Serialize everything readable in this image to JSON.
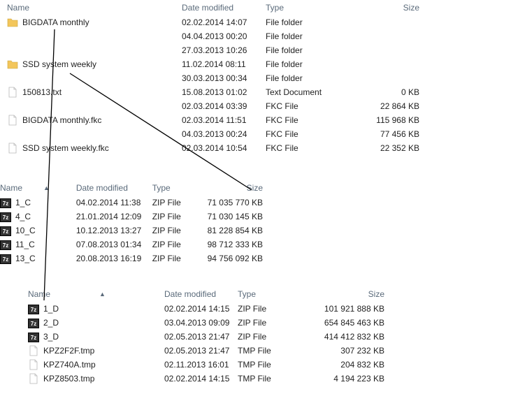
{
  "headers": {
    "name": "Name",
    "date": "Date modified",
    "type": "Type",
    "size": "Size"
  },
  "pane1": {
    "rows": [
      {
        "icon": "folder",
        "name": "BIGDATA monthly",
        "date": "02.02.2014 14:07",
        "type": "File folder",
        "size": ""
      },
      {
        "icon": "",
        "name": "",
        "date": "04.04.2013 00:20",
        "type": "File folder",
        "size": ""
      },
      {
        "icon": "",
        "name": "",
        "date": "27.03.2013 10:26",
        "type": "File folder",
        "size": ""
      },
      {
        "icon": "folder",
        "name": "SSD system weekly",
        "date": "11.02.2014 08:11",
        "type": "File folder",
        "size": ""
      },
      {
        "icon": "",
        "name": "",
        "date": "30.03.2013 00:34",
        "type": "File folder",
        "size": ""
      },
      {
        "icon": "file",
        "name": "150813.txt",
        "date": "15.08.2013 01:02",
        "type": "Text Document",
        "size": "0 KB"
      },
      {
        "icon": "",
        "name": "",
        "date": "02.03.2014 03:39",
        "type": "FKC File",
        "size": "22 864 KB"
      },
      {
        "icon": "file",
        "name": "BIGDATA monthly.fkc",
        "date": "02.03.2014 11:51",
        "type": "FKC File",
        "size": "115 968 KB"
      },
      {
        "icon": "",
        "name": "",
        "date": "04.03.2013 00:24",
        "type": "FKC File",
        "size": "77 456 KB"
      },
      {
        "icon": "file",
        "name": "SSD system weekly.fkc",
        "date": "02.03.2014 10:54",
        "type": "FKC File",
        "size": "22 352 KB"
      }
    ]
  },
  "pane2": {
    "rows": [
      {
        "icon": "zip",
        "name": "1_C",
        "date": "04.02.2014 11:38",
        "type": "ZIP File",
        "size": "71 035 770 KB"
      },
      {
        "icon": "zip",
        "name": "4_C",
        "date": "21.01.2014 12:09",
        "type": "ZIP File",
        "size": "71 030 145 KB"
      },
      {
        "icon": "zip",
        "name": "10_C",
        "date": "10.12.2013 13:27",
        "type": "ZIP File",
        "size": "81 228 854 KB"
      },
      {
        "icon": "zip",
        "name": "11_C",
        "date": "07.08.2013 01:34",
        "type": "ZIP File",
        "size": "98 712 333 KB"
      },
      {
        "icon": "zip",
        "name": "13_C",
        "date": "20.08.2013 16:19",
        "type": "ZIP File",
        "size": "94 756 092 KB"
      }
    ]
  },
  "pane3": {
    "rows": [
      {
        "icon": "zip",
        "name": "1_D",
        "date": "02.02.2014 14:15",
        "type": "ZIP File",
        "size": "101 921 888 KB"
      },
      {
        "icon": "zip",
        "name": "2_D",
        "date": "03.04.2013 09:09",
        "type": "ZIP File",
        "size": "654 845 463 KB"
      },
      {
        "icon": "zip",
        "name": "3_D",
        "date": "02.05.2013 21:47",
        "type": "ZIP File",
        "size": "414 412 832 KB"
      },
      {
        "icon": "file",
        "name": "KPZ2F2F.tmp",
        "date": "02.05.2013 21:47",
        "type": "TMP File",
        "size": "307 232 KB"
      },
      {
        "icon": "file",
        "name": "KPZ740A.tmp",
        "date": "02.11.2013 16:01",
        "type": "TMP File",
        "size": "204 832 KB"
      },
      {
        "icon": "file",
        "name": "KPZ8503.tmp",
        "date": "02.02.2014 14:15",
        "type": "TMP File",
        "size": "4 194 223 KB"
      }
    ]
  },
  "icons": {
    "zip_label": "7z"
  }
}
